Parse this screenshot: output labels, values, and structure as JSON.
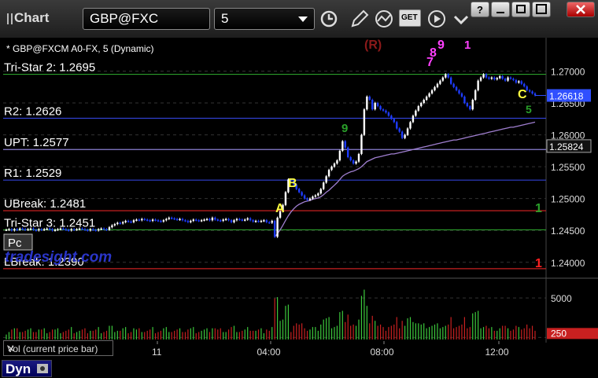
{
  "app": {
    "title": "Chart",
    "symbol": "GBP@FXC",
    "interval": "5",
    "get_label": "GET"
  },
  "chart_header": "* GBP@FXCM A0-FX, 5 (Dynamic)",
  "watermark": "tradesight.com",
  "pc_badge": "Pc",
  "volume_tab": {
    "label": "Vol (current price bar)",
    "close": "✕"
  },
  "status_button": "Dyn",
  "colors": {
    "background": "#000000",
    "up_candle": "#ffffff",
    "down_candle": "#1e3cff",
    "r_line": "#3040d0",
    "upt_line": "#8a7fd0",
    "tristar_line": "#2a9a2a",
    "break_line": "#c82020",
    "ma_line": "#a07fd0",
    "vol_up": "#3cc83c",
    "vol_down": "#c82020",
    "last_price": "#3050ff"
  },
  "chart_data": {
    "type": "candlestick",
    "title": "* GBP@FXCM A0-FX, 5 (Dynamic)",
    "ylim": [
      1.238,
      1.2745
    ],
    "y_ticks": [
      "1.27000",
      "1.26500",
      "1.26000",
      "1.25500",
      "1.25000",
      "1.24500",
      "1.24000"
    ],
    "y_tick_values": [
      1.27,
      1.265,
      1.26,
      1.255,
      1.25,
      1.245,
      1.24
    ],
    "x_ticks": [
      "11",
      "04:00",
      "08:00",
      "12:00"
    ],
    "last_price": "1.26618",
    "last_price_value": 1.26618,
    "ma_value_label": "1.25824",
    "ma_value": 1.25824,
    "levels": [
      {
        "label": "Tri-Star 2: 1.2695",
        "value": 1.2695,
        "kind": "tristar"
      },
      {
        "label": "R2: 1.2626",
        "value": 1.2626,
        "kind": "r"
      },
      {
        "label": "UPT: 1.2577",
        "value": 1.2577,
        "kind": "upt"
      },
      {
        "label": "R1: 1.2529",
        "value": 1.2529,
        "kind": "r"
      },
      {
        "label": "UBreak: 1.2481",
        "value": 1.2481,
        "kind": "break"
      },
      {
        "label": "Tri-Star 3: 1.2451",
        "value": 1.2451,
        "kind": "tristar"
      },
      {
        "label": "LBreak: 1.2390",
        "value": 1.239,
        "kind": "break"
      }
    ],
    "pattern_labels": [
      {
        "text": "(R)",
        "color": "#8b1a1a"
      },
      {
        "text": "A",
        "color": "#ffff40"
      },
      {
        "text": "B",
        "color": "#ffff40"
      },
      {
        "text": "C",
        "color": "#ffff40"
      },
      {
        "text": "1",
        "color": "#ff2020"
      },
      {
        "text": "1",
        "color": "#2aa02a"
      },
      {
        "text": "8",
        "color": "#ff40ff"
      },
      {
        "text": "9",
        "color": "#ff40ff"
      },
      {
        "text": "7",
        "color": "#ff40ff"
      },
      {
        "text": "1",
        "color": "#ff40ff"
      },
      {
        "text": "9",
        "color": "#2aa02a"
      },
      {
        "text": "5",
        "color": "#2aa02a"
      }
    ],
    "close_series": [
      1.2451,
      1.2452,
      1.245,
      1.2452,
      1.2451,
      1.2453,
      1.2452,
      1.2451,
      1.2452,
      1.2453,
      1.2451,
      1.245,
      1.2452,
      1.2451,
      1.2452,
      1.2453,
      1.2452,
      1.245,
      1.2451,
      1.2452,
      1.2453,
      1.2452,
      1.2451,
      1.245,
      1.2452,
      1.2451,
      1.2452,
      1.2453,
      1.2452,
      1.2451,
      1.245,
      1.2452,
      1.2451,
      1.245,
      1.2452,
      1.2453,
      1.2452,
      1.2451,
      1.2455,
      1.2458,
      1.246,
      1.2462,
      1.2461,
      1.2463,
      1.2465,
      1.2464,
      1.2463,
      1.2466,
      1.2467,
      1.2466,
      1.2468,
      1.2467,
      1.2466,
      1.2465,
      1.2467,
      1.2466,
      1.2465,
      1.2464,
      1.2466,
      1.2468,
      1.247,
      1.2469,
      1.2468,
      1.2467,
      1.2468,
      1.2466,
      1.2465,
      1.2463,
      1.2465,
      1.2467,
      1.2466,
      1.2465,
      1.2466,
      1.2467,
      1.2468,
      1.2466,
      1.247,
      1.2467,
      1.2466,
      1.2465,
      1.2467,
      1.2468,
      1.2466,
      1.2463,
      1.2466,
      1.2468,
      1.2467,
      1.2466,
      1.2467,
      1.2469,
      1.2466,
      1.2464,
      1.2465,
      1.2464,
      1.2465,
      1.2466,
      1.2463,
      1.2462,
      1.2465,
      1.244,
      1.247,
      1.248,
      1.249,
      1.251,
      1.253,
      1.2528,
      1.2522,
      1.2515,
      1.251,
      1.2505,
      1.25,
      1.2498,
      1.25,
      1.2503,
      1.2505,
      1.2508,
      1.2515,
      1.2525,
      1.2535,
      1.2545,
      1.255,
      1.2555,
      1.256,
      1.2575,
      1.259,
      1.258,
      1.2565,
      1.256,
      1.2555,
      1.2558,
      1.257,
      1.26,
      1.264,
      1.266,
      1.2655,
      1.264,
      1.265,
      1.2645,
      1.264,
      1.2638,
      1.2635,
      1.263,
      1.2625,
      1.262,
      1.261,
      1.2605,
      1.2595,
      1.26,
      1.261,
      1.262,
      1.263,
      1.2638,
      1.2645,
      1.265,
      1.2655,
      1.266,
      1.2665,
      1.267,
      1.2675,
      1.268,
      1.2685,
      1.269,
      1.2695,
      1.269,
      1.268,
      1.2675,
      1.267,
      1.2665,
      1.266,
      1.265,
      1.2645,
      1.264,
      1.2655,
      1.267,
      1.2685,
      1.269,
      1.2695,
      1.269,
      1.2688,
      1.269,
      1.2687,
      1.2689,
      1.2692,
      1.2688,
      1.2685,
      1.269,
      1.2688,
      1.2686,
      1.2682,
      1.2684,
      1.268,
      1.2676,
      1.267,
      1.2668,
      1.2665,
      1.2662
    ],
    "ma_series": [
      null,
      null,
      null,
      null,
      null,
      null,
      null,
      null,
      null,
      null,
      null,
      null,
      null,
      null,
      null,
      null,
      null,
      null,
      null,
      null,
      null,
      null,
      null,
      null,
      null,
      null,
      null,
      null,
      null,
      null,
      null,
      null,
      null,
      null,
      null,
      null,
      null,
      null,
      null,
      null,
      null,
      null,
      null,
      null,
      null,
      null,
      null,
      null,
      null,
      null,
      null,
      null,
      null,
      null,
      null,
      null,
      null,
      null,
      null,
      null,
      null,
      null,
      null,
      null,
      null,
      null,
      null,
      null,
      null,
      null,
      null,
      null,
      null,
      null,
      null,
      null,
      null,
      null,
      null,
      null,
      null,
      null,
      null,
      null,
      null,
      null,
      null,
      null,
      null,
      null,
      null,
      null,
      null,
      null,
      null,
      null,
      null,
      null,
      null,
      1.244,
      1.2445,
      1.2451,
      1.2458,
      1.2466,
      1.2473,
      1.2479,
      1.2484,
      1.2488,
      1.2491,
      1.2493,
      1.2495,
      1.2496,
      1.2497,
      1.2499,
      1.25,
      1.2501,
      1.2503,
      1.2506,
      1.251,
      1.2513,
      1.2517,
      1.2521,
      1.2525,
      1.253,
      1.2535,
      1.2538,
      1.254,
      1.2542,
      1.2543,
      1.2545,
      1.2547,
      1.255,
      1.2554,
      1.2558,
      1.256,
      1.2562,
      1.2564,
      1.2565,
      1.2566,
      1.2567,
      1.2568,
      1.2569,
      1.257,
      1.257,
      1.2571,
      1.2572,
      1.2573,
      1.2574,
      1.2575,
      1.2576,
      1.2577,
      1.2578,
      1.2579,
      1.258,
      1.2581,
      1.2582,
      1.2583,
      1.2584,
      1.2585,
      1.2586,
      1.2587,
      1.2588,
      1.2589,
      1.259,
      1.2591,
      1.2592,
      1.2592,
      1.2593,
      1.2594,
      1.2595,
      1.2596,
      1.2597,
      1.2598,
      1.2599,
      1.26,
      1.2601,
      1.2602,
      1.2603,
      1.2604,
      1.2605,
      1.2606,
      1.2607,
      1.2608,
      1.2609,
      1.261,
      1.2611,
      1.2612,
      1.2612,
      1.2613,
      1.2614,
      1.2615,
      1.2616,
      1.2617,
      1.2618,
      1.2619,
      1.262
    ],
    "volume": {
      "y_ticks": [
        "5000",
        "250"
      ],
      "y_tick_values": [
        5000,
        250
      ],
      "ylim": [
        0,
        7000
      ]
    }
  }
}
